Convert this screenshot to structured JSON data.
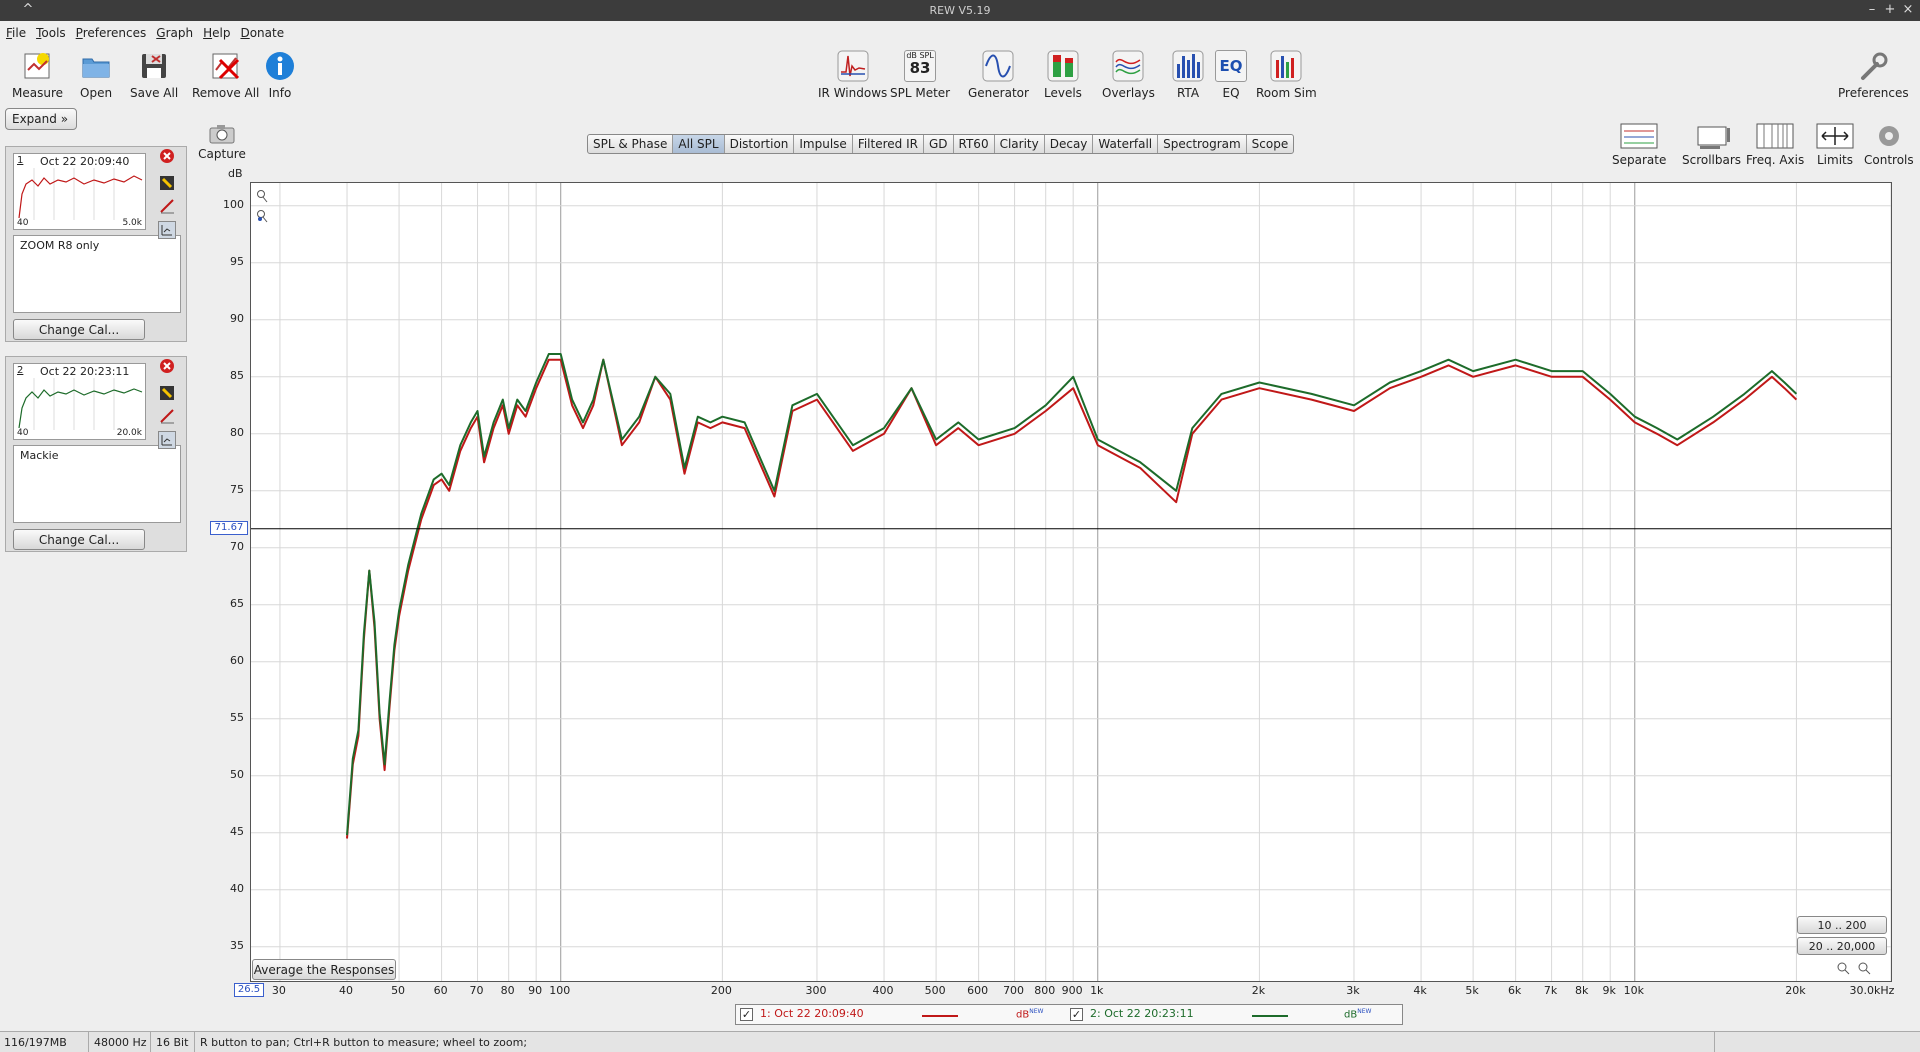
{
  "app": {
    "title": "REW V5.19"
  },
  "menu": [
    "File",
    "Tools",
    "Preferences",
    "Graph",
    "Help",
    "Donate"
  ],
  "toolbar_left": [
    {
      "label": "Measure",
      "icon": "measure-icon"
    },
    {
      "label": "Open",
      "icon": "folder-icon"
    },
    {
      "label": "Save All",
      "icon": "save-icon"
    },
    {
      "label": "Remove All",
      "icon": "remove-all-icon"
    },
    {
      "label": "Info",
      "icon": "info-icon"
    }
  ],
  "toolbar_center": [
    {
      "label": "IR Windows",
      "icon": "ir-windows-icon"
    },
    {
      "label": "SPL Meter",
      "icon": "spl-meter-icon",
      "display": "83",
      "unit": "dB SPL"
    },
    {
      "label": "Generator",
      "icon": "generator-icon"
    },
    {
      "label": "Levels",
      "icon": "levels-icon"
    },
    {
      "label": "Overlays",
      "icon": "overlays-icon"
    },
    {
      "label": "RTA",
      "icon": "rta-icon"
    },
    {
      "label": "EQ",
      "icon": "eq-icon"
    },
    {
      "label": "Room Sim",
      "icon": "room-sim-icon"
    }
  ],
  "toolbar_right": {
    "label": "Preferences",
    "icon": "wrench-icon"
  },
  "left_panel": {
    "expand_label": "Expand",
    "measurements": [
      {
        "num": "1",
        "timestamp": "Oct 22 20:09:40",
        "lo": "40",
        "hi": "5.0k",
        "notes": "ZOOM R8 only",
        "cal_label": "Change Cal...",
        "color": "#c01818"
      },
      {
        "num": "2",
        "timestamp": "Oct 22 20:23:11",
        "lo": "40",
        "hi": "20.0k",
        "notes": "Mackie",
        "cal_label": "Change Cal...",
        "color": "#1d6b2a"
      }
    ]
  },
  "capture_label": "Capture",
  "tabs": [
    "SPL & Phase",
    "All SPL",
    "Distortion",
    "Impulse",
    "Filtered IR",
    "GD",
    "RT60",
    "Clarity",
    "Decay",
    "Waterfall",
    "Spectrogram",
    "Scope"
  ],
  "active_tab": "All SPL",
  "graph_tools": [
    "Separate",
    "Scrollbars",
    "Freq. Axis",
    "Limits",
    "Controls"
  ],
  "graph": {
    "y_unit": "dB",
    "y_ticks": [
      "100",
      "95",
      "90",
      "85",
      "80",
      "75",
      "70",
      "65",
      "60",
      "55",
      "50",
      "45",
      "40",
      "35"
    ],
    "x_ticks": [
      "30",
      "40",
      "50",
      "60",
      "70",
      "80",
      "90",
      "100",
      "200",
      "300",
      "400",
      "500",
      "600",
      "700",
      "800",
      "900",
      "1k",
      "2k",
      "3k",
      "4k",
      "5k",
      "6k",
      "7k",
      "8k",
      "9k",
      "10k",
      "20k",
      "30.0kHz"
    ],
    "cursor_value": "71.67",
    "x_min_value": "26.5",
    "average_button": "Average the Responses",
    "range_buttons": [
      "10 .. 200",
      "20 .. 20,000"
    ]
  },
  "chart_data": {
    "type": "line",
    "xlabel": "",
    "ylabel": "dB",
    "x_scale": "log",
    "xlim": [
      26.5,
      30000
    ],
    "ylim": [
      32,
      102
    ],
    "cursor_level": 71.67,
    "grid": true,
    "series": [
      {
        "name": "1: Oct 22 20:09:40",
        "color": "#c01818",
        "x": [
          40,
          41,
          42,
          43,
          44,
          45,
          46,
          47,
          48,
          49,
          50,
          52,
          55,
          58,
          60,
          62,
          65,
          68,
          70,
          72,
          75,
          78,
          80,
          83,
          86,
          90,
          95,
          100,
          105,
          110,
          115,
          120,
          130,
          140,
          150,
          160,
          170,
          180,
          190,
          200,
          220,
          250,
          270,
          300,
          350,
          400,
          450,
          500,
          550,
          600,
          700,
          800,
          900,
          1000,
          1200,
          1400,
          1500,
          1700,
          2000,
          2500,
          3000,
          3500,
          4000,
          4500,
          5000,
          6000,
          7000,
          8000,
          9000,
          10000,
          11000,
          12000,
          14000,
          16000,
          18000,
          19000,
          20000
        ],
        "y": [
          44.5,
          51,
          53.5,
          62,
          68,
          63,
          55,
          50.5,
          56,
          61,
          64,
          68,
          72.5,
          75.5,
          76,
          75,
          78.5,
          80.5,
          81.5,
          77.5,
          80.5,
          82.5,
          80,
          82.5,
          81.5,
          84,
          86.5,
          86.5,
          82.5,
          80.5,
          82.5,
          86.5,
          79,
          81,
          85,
          83,
          76.5,
          81,
          80.5,
          81,
          80.5,
          74.5,
          82,
          83,
          78.5,
          80,
          84,
          79,
          80.5,
          79,
          80,
          82,
          84,
          79,
          77,
          74,
          80,
          83,
          84,
          83,
          82,
          84,
          85,
          86,
          85,
          86,
          85,
          85,
          83,
          81,
          80,
          79,
          81,
          83,
          85,
          84,
          83
        ]
      },
      {
        "name": "2: Oct 22 20:23:11",
        "color": "#1d6b2a",
        "x": [
          40,
          41,
          42,
          43,
          44,
          45,
          46,
          47,
          48,
          49,
          50,
          52,
          55,
          58,
          60,
          62,
          65,
          68,
          70,
          72,
          75,
          78,
          80,
          83,
          86,
          90,
          95,
          100,
          105,
          110,
          115,
          120,
          130,
          140,
          150,
          160,
          170,
          180,
          190,
          200,
          220,
          250,
          270,
          300,
          350,
          400,
          450,
          500,
          550,
          600,
          700,
          800,
          900,
          1000,
          1200,
          1400,
          1500,
          1700,
          2000,
          2500,
          3000,
          3500,
          4000,
          4500,
          5000,
          6000,
          7000,
          8000,
          9000,
          10000,
          11000,
          12000,
          14000,
          16000,
          18000,
          19000,
          20000
        ],
        "y": [
          44.8,
          51.5,
          54,
          62.5,
          68,
          63.5,
          55.5,
          51,
          56.5,
          61.5,
          64.5,
          68.5,
          73,
          76,
          76.5,
          75.5,
          79,
          81,
          82,
          78,
          81,
          83,
          80.5,
          83,
          82,
          84.5,
          87,
          87,
          83,
          81,
          83,
          86.5,
          79.5,
          81.5,
          85,
          83.5,
          77,
          81.5,
          81,
          81.5,
          81,
          75,
          82.5,
          83.5,
          79,
          80.5,
          84,
          79.5,
          81,
          79.5,
          80.5,
          82.5,
          85,
          79.5,
          77.5,
          75,
          80.5,
          83.5,
          84.5,
          83.5,
          82.5,
          84.5,
          85.5,
          86.5,
          85.5,
          86.5,
          85.5,
          85.5,
          83.5,
          81.5,
          80.5,
          79.5,
          81.5,
          83.5,
          85.5,
          84.5,
          83.5
        ]
      }
    ]
  },
  "legend": [
    {
      "label": "1: Oct 22 20:09:40",
      "unit": "dB",
      "badge": "NEW",
      "color": "#c01818"
    },
    {
      "label": "2: Oct 22 20:23:11",
      "unit": "dB",
      "badge": "NEW",
      "color": "#1d6b2a"
    }
  ],
  "status": {
    "memory": "116/197MB",
    "rate": "48000 Hz",
    "bits": "16 Bit",
    "hint": "R button to pan; Ctrl+R button to measure; wheel to zoom;"
  }
}
